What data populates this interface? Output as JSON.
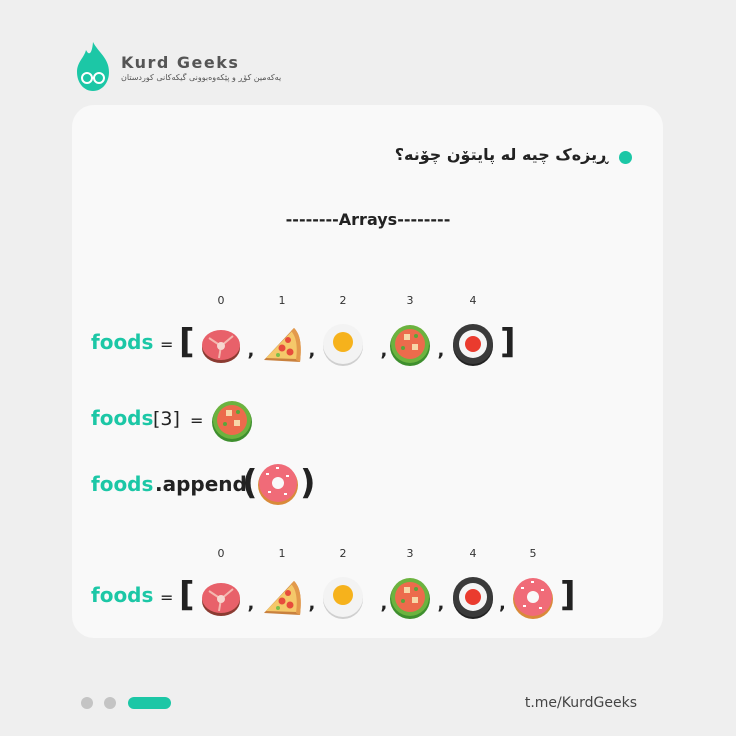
{
  "brand": {
    "name": "Kurd Geeks",
    "tagline": "یەکەمین کۆڕ و پێکەوەبوونی گیکەکانی کوردستان",
    "color": "#1cc7a6"
  },
  "card": {
    "title": "ڕیزەک چیە لە پایتۆن چۆنە؟",
    "section": "--------Arrays--------"
  },
  "row1": {
    "var": "foods",
    "eq": "=",
    "open": "[",
    "close": "]",
    "indices": [
      "0",
      "1",
      "2",
      "3",
      "4"
    ],
    "items": [
      "steak",
      "pizza",
      "egg",
      "salad-bowl",
      "sushi"
    ]
  },
  "row2": {
    "var": "foods",
    "index_expr": "[3]",
    "eq": "=",
    "item": "salad-bowl"
  },
  "row3": {
    "var": "foods",
    "method": ".append",
    "open": "(",
    "close": ")",
    "item": "donut"
  },
  "row4": {
    "var": "foods",
    "eq": "=",
    "open": "[",
    "close": "]",
    "indices": [
      "0",
      "1",
      "2",
      "3",
      "4",
      "5"
    ],
    "items": [
      "steak",
      "pizza",
      "egg",
      "salad-bowl",
      "sushi",
      "donut"
    ]
  },
  "comma": ",",
  "footer": {
    "url": "t.me/KurdGeeks"
  }
}
